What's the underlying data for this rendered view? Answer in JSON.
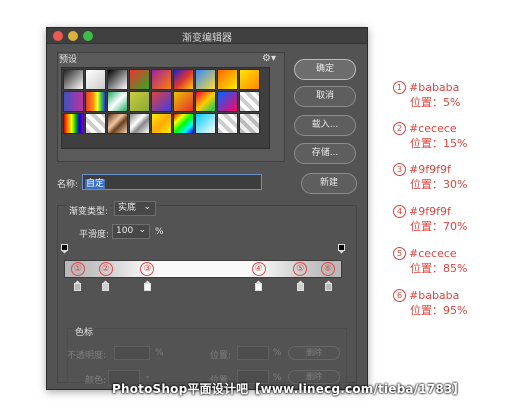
{
  "dialog": {
    "title": "渐变编辑器",
    "presets_label": "预设",
    "gear_icon": "gear-icon",
    "buttons": {
      "ok": "确定",
      "cancel": "取消",
      "load": "载入...",
      "save": "存储...",
      "new": "新建"
    },
    "name_label": "名称:",
    "name_value": "自定",
    "gradient_type_label": "渐变类型:",
    "gradient_type_value": "实底",
    "smoothness_label": "平滑度:",
    "smoothness_value": "100",
    "smoothness_unit": "%",
    "stops": {
      "section_label": "色标",
      "opacity_label": "不透明度:",
      "opacity_unit": "%",
      "location_label": "位置:",
      "location_unit": "%",
      "delete_label": "删除",
      "color_label": "颜色:",
      "location2_label": "位置:",
      "location2_unit": "%",
      "delete2_label": "删除"
    },
    "gradient_stops": [
      {
        "marker": "①",
        "color": "#bababa",
        "position_percent": 5
      },
      {
        "marker": "②",
        "color": "#cecece",
        "position_percent": 15
      },
      {
        "marker": "③",
        "color": "#f9f9f9",
        "position_percent": 30
      },
      {
        "marker": "④",
        "color": "#f9f9f9",
        "position_percent": 70
      },
      {
        "marker": "⑤",
        "color": "#cecece",
        "position_percent": 85
      },
      {
        "marker": "⑥",
        "color": "#bababa",
        "position_percent": 95
      }
    ]
  },
  "annotations": [
    {
      "num": "1",
      "color": "#bababa",
      "pos": "位置：5%"
    },
    {
      "num": "2",
      "color": "#cecece",
      "pos": "位置：15%"
    },
    {
      "num": "3",
      "color": "#9f9f9f",
      "pos": "位置：30%"
    },
    {
      "num": "4",
      "color": "#9f9f9f",
      "pos": "位置：70%"
    },
    {
      "num": "5",
      "color": "#cecece",
      "pos": "位置：85%"
    },
    {
      "num": "6",
      "color": "#bababa",
      "pos": "位置：95%"
    }
  ],
  "watermark": "PhotoShop平面设计吧【www.linecg.com/tieba/1783】",
  "accent_color": "#e0443d"
}
